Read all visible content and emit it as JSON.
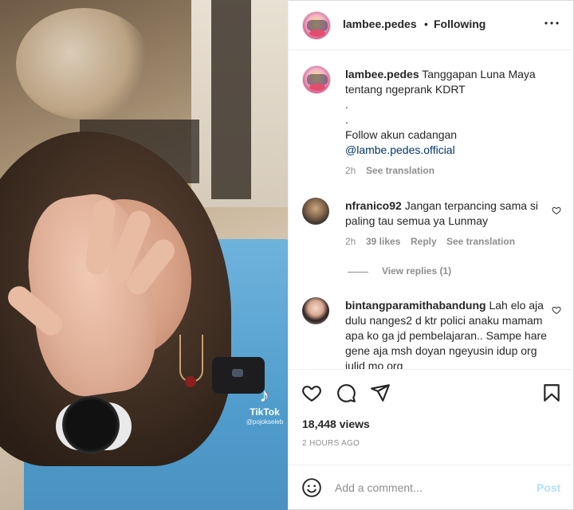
{
  "post": {
    "username": "lambee.pedes",
    "separator": "•",
    "follow_status": "Following",
    "more_label": "More options"
  },
  "media": {
    "watermark_logo": "♪",
    "watermark_name": "TikTok",
    "watermark_handle": "@pojokseleb"
  },
  "caption": {
    "username": "lambee.pedes",
    "line1": "Tanggapan Luna Maya tentang ngeprank KDRT",
    "line2": ".",
    "line3": ".",
    "line4": "Follow akun cadangan",
    "link": "@lambe.pedes.official",
    "time": "2h",
    "see_translation": "See translation"
  },
  "comments": [
    {
      "username": "nfranico92",
      "text": "Jangan terpancing sama si paling tau semua ya Lunmay",
      "time": "2h",
      "likes": "39 likes",
      "reply": "Reply",
      "see_translation": "See translation",
      "view_replies": "View replies (1)"
    },
    {
      "username": "bintangparamithabandung",
      "text": "Lah elo aja dulu nanges2 d ktr polici anaku mamam apa ko ga jd pembelajaran.. Sampe hare gene aja msh doyan ngeyusin idup org julid mo org"
    }
  ],
  "actions": {
    "views": "18,448 views",
    "time_ago": "2 HOURS AGO"
  },
  "add_comment": {
    "placeholder": "Add a comment...",
    "post_label": "Post"
  },
  "colors": {
    "link": "#00376b",
    "muted": "#8e8e8e",
    "post_disabled": "#b2dffc"
  }
}
